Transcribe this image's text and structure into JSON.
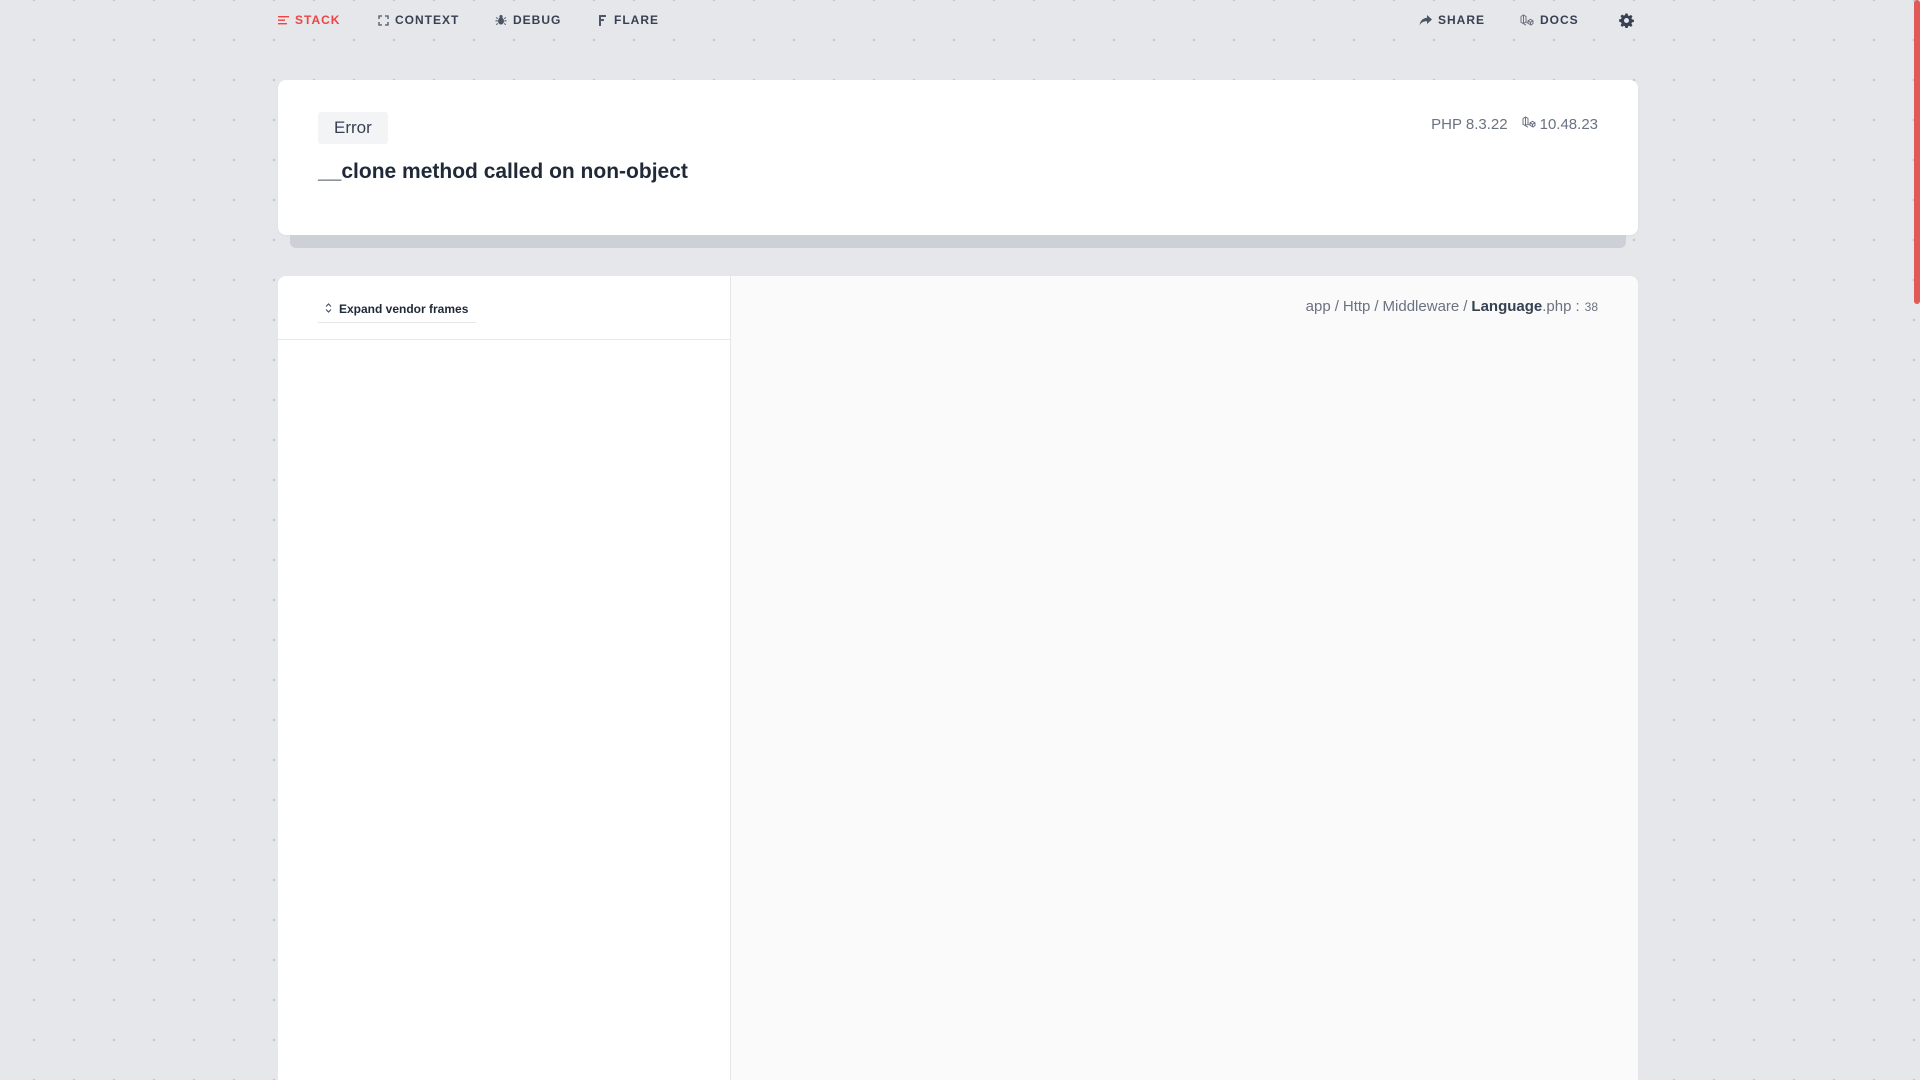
{
  "nav": {
    "stack_label": "STACK",
    "context_label": "CONTEXT",
    "debug_label": "DEBUG",
    "flare_label": "FLARE",
    "share_label": "SHARE",
    "docs_label": "DOCS",
    "icons": {
      "stack": "stack-lines-icon",
      "context": "expand-corners-icon",
      "debug": "bug-icon",
      "flare": "flare-icon",
      "share": "share-arrow-icon",
      "docs": "laravel-icon",
      "settings": "gear-icon"
    },
    "active_color": "#ef4444"
  },
  "error": {
    "exception_class": "Error",
    "message": "__clone method called on non-object",
    "php_version": "PHP 8.3.22",
    "laravel_version": "10.48.23"
  },
  "stack": {
    "expand_vendor_label": "Expand vendor frames",
    "file_path": {
      "segments": [
        "app",
        "Http",
        "Middleware"
      ],
      "separator": "/",
      "file_name": "Language",
      "file_ext": ".php",
      "line_separator": ":",
      "line": "38"
    }
  }
}
